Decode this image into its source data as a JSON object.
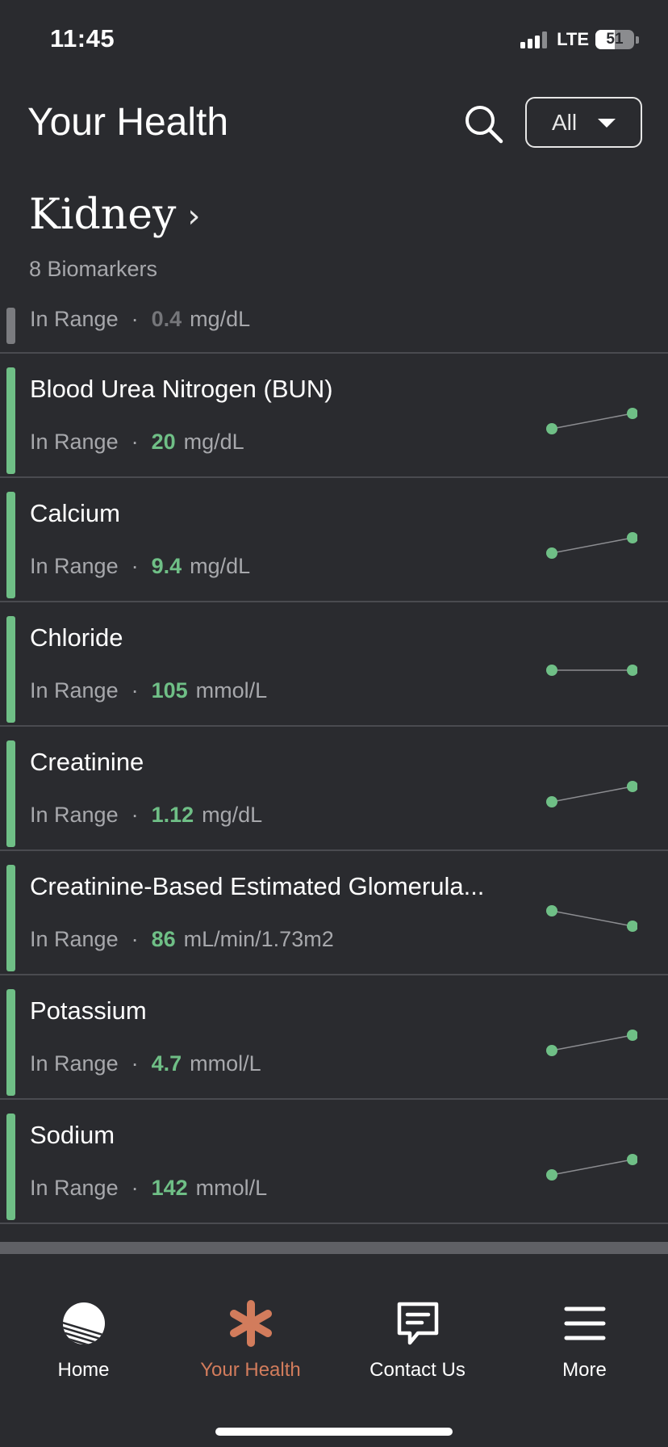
{
  "status_bar": {
    "time": "11:45",
    "network": "LTE",
    "battery": "51",
    "battery_level": 0.51
  },
  "header": {
    "title": "Your Health",
    "search_icon": "search-icon",
    "filter": {
      "selected": "All",
      "icon": "caret-down-icon"
    }
  },
  "section": {
    "title": "Kidney",
    "chevron": "›",
    "count_label": "8 Biomarkers"
  },
  "partial_row": {
    "status": "In Range",
    "separator": "·",
    "value": "0.4",
    "unit": "mg/dL"
  },
  "biomarkers": [
    {
      "name": "Blood Urea Nitrogen (BUN)",
      "status": "In Range",
      "separator": "·",
      "value": "20",
      "unit": "mg/dL",
      "trend": "up"
    },
    {
      "name": "Calcium",
      "status": "In Range",
      "separator": "·",
      "value": "9.4",
      "unit": "mg/dL",
      "trend": "up"
    },
    {
      "name": "Chloride",
      "status": "In Range",
      "separator": "·",
      "value": "105",
      "unit": "mmol/L",
      "trend": "flat"
    },
    {
      "name": "Creatinine",
      "status": "In Range",
      "separator": "·",
      "value": "1.12",
      "unit": "mg/dL",
      "trend": "up"
    },
    {
      "name": "Creatinine-Based Estimated Glomerula...",
      "status": "In Range",
      "separator": "·",
      "value": "86",
      "unit": "mL/min/1.73m2",
      "trend": "down"
    },
    {
      "name": "Potassium",
      "status": "In Range",
      "separator": "·",
      "value": "4.7",
      "unit": "mmol/L",
      "trend": "up"
    },
    {
      "name": "Sodium",
      "status": "In Range",
      "separator": "·",
      "value": "142",
      "unit": "mmol/L",
      "trend": "up"
    }
  ],
  "colors": {
    "background": "#2a2b2f",
    "in_range": "#6fbf86",
    "accent": "#d27c5c",
    "muted_text": "#a7a8ac"
  },
  "tabbar": {
    "tabs": [
      {
        "label": "Home",
        "icon": "home-sphere-icon",
        "active": false
      },
      {
        "label": "Your Health",
        "icon": "asterisk-icon",
        "active": true
      },
      {
        "label": "Contact Us",
        "icon": "chat-bubble-icon",
        "active": false
      },
      {
        "label": "More",
        "icon": "menu-icon",
        "active": false
      }
    ]
  }
}
